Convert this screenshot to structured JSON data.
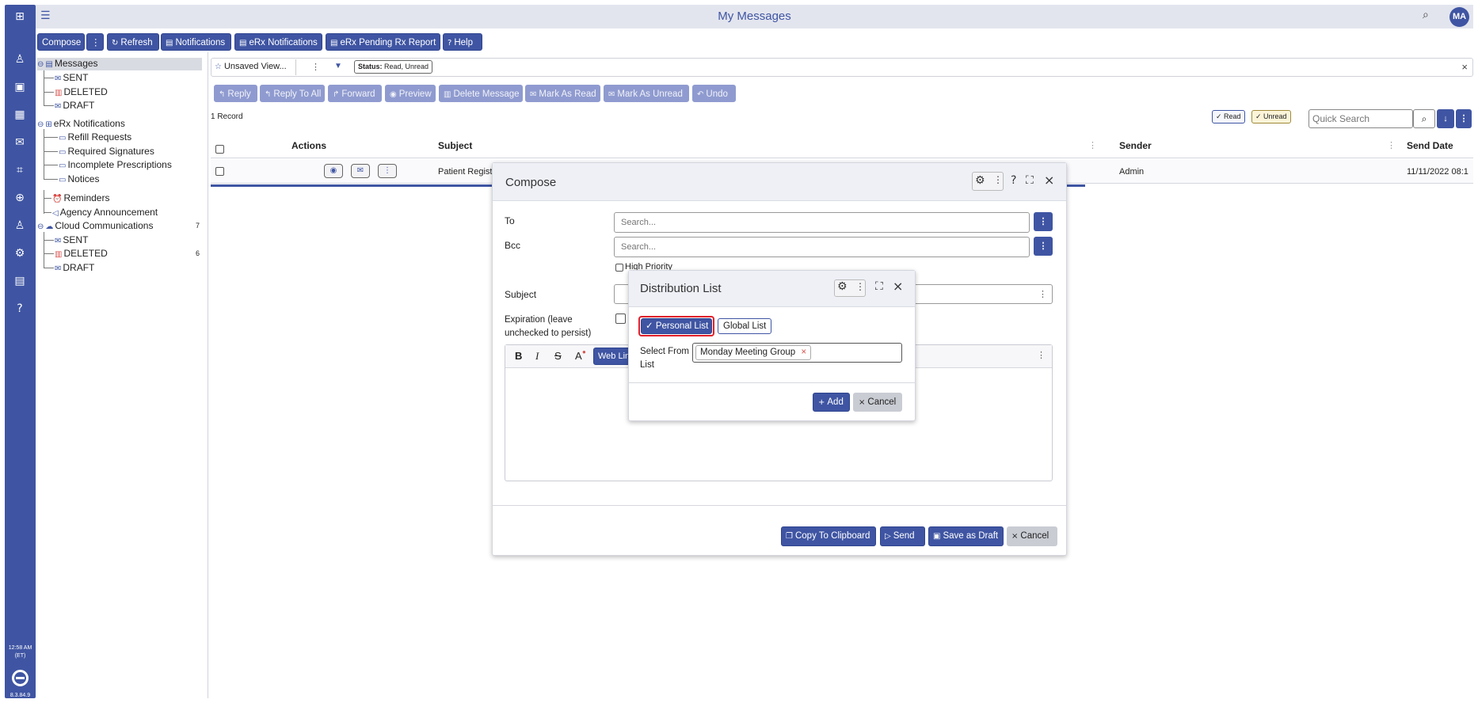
{
  "app": {
    "title": "My Messages",
    "avatar": "MA",
    "clock": "12:58 AM",
    "clock_tz": "(ET)",
    "version": "8.3.84.9"
  },
  "toolbar": {
    "compose": "Compose",
    "compose_more": "⋮",
    "refresh": "Refresh",
    "notifications": "Notifications",
    "erx_notifications": "eRx Notifications",
    "erx_pending": "eRx Pending Rx Report",
    "help": "Help"
  },
  "tree": {
    "messages": "Messages",
    "sent": "SENT",
    "deleted": "DELETED",
    "draft": "DRAFT",
    "erx_notifications": "eRx Notifications",
    "refill": "Refill Requests",
    "required_signatures": "Required Signatures",
    "incomplete": "Incomplete Prescriptions",
    "notices": "Notices",
    "reminders": "Reminders",
    "agency": "Agency Announcement",
    "cloud": "Cloud Communications",
    "cloud_count": "7",
    "cloud_sent": "SENT",
    "cloud_deleted": "DELETED",
    "cloud_deleted_count": "6",
    "cloud_draft": "DRAFT"
  },
  "filter": {
    "view": "Unsaved View...",
    "status_label": "Status:",
    "status_value": "Read, Unread"
  },
  "actions": {
    "reply": "Reply",
    "reply_all": "Reply To All",
    "forward": "Forward",
    "preview": "Preview",
    "delete": "Delete Message",
    "mark_read": "Mark As Read",
    "mark_unread": "Mark As Unread",
    "undo": "Undo"
  },
  "grid": {
    "record_count": "1 Record",
    "read_chip": "✓ Read",
    "unread_chip": "✓ Unread",
    "quick_search_placeholder": "Quick Search",
    "columns": {
      "actions": "Actions",
      "subject": "Subject",
      "sender": "Sender",
      "send_date": "Send Date"
    },
    "rows": [
      {
        "subject": "Patient Regist",
        "sender": "Admin",
        "send_date": "11/11/2022 08:1"
      }
    ]
  },
  "compose": {
    "title": "Compose",
    "to_label": "To",
    "bcc_label": "Bcc",
    "search_placeholder": "Search...",
    "high_priority": "High Priority",
    "subject_label": "Subject",
    "expiration_label": "Expiration (leave unchecked to persist)",
    "bold": "B",
    "italic": "I",
    "strike": "S",
    "font_color": "A",
    "web_link": "Web Lin",
    "copy_clipboard": "Copy To Clipboard",
    "send": "Send",
    "save_draft": "Save as Draft",
    "cancel": "Cancel"
  },
  "distribution": {
    "title": "Distribution List",
    "personal_list": "✓ Personal List",
    "global_list": "Global List",
    "select_from_label": "Select From List",
    "selected_item": "Monday Meeting Group",
    "add": "Add",
    "cancel": "Cancel"
  },
  "colors": {
    "primary": "#3f55a3",
    "highlight": "#e0202a",
    "light_button": "#8f9bd0"
  }
}
